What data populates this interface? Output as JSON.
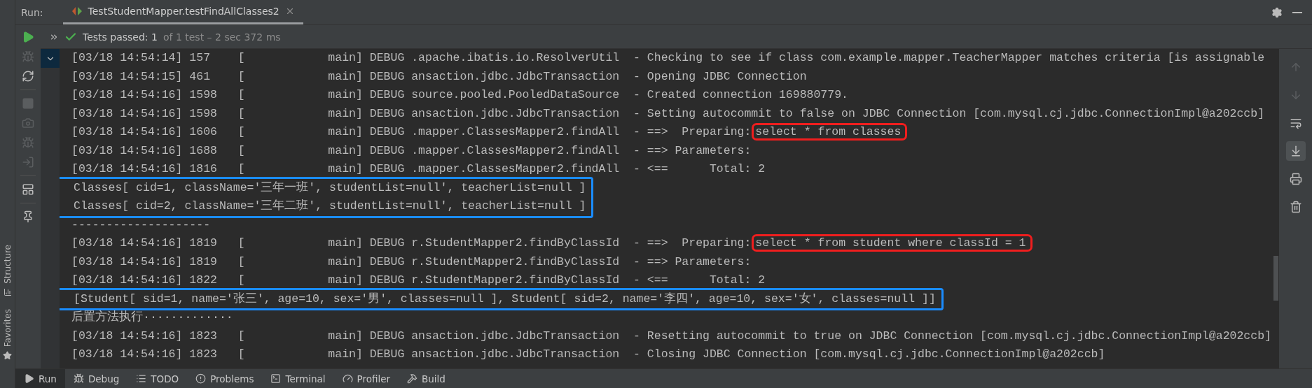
{
  "run_tab": {
    "label": "Run:",
    "title": "TestStudentMapper.testFindAllClasses2",
    "selected": true
  },
  "tests_status": {
    "passed": "Tests passed: 1",
    "detail": "of 1 test – 2 sec 372 ms"
  },
  "side_panels": [
    {
      "label": "Structure"
    },
    {
      "label": "Favorites"
    }
  ],
  "console": {
    "blocks": [
      {
        "kind": "line",
        "text": "[03/18 14:54:14] 157    [            main] DEBUG .apache.ibatis.io.ResolverUtil  - Checking to see if class com.example.mapper.TeacherMapper matches criteria [is assignable"
      },
      {
        "kind": "line",
        "text": "[03/18 14:54:15] 461    [            main] DEBUG ansaction.jdbc.JdbcTransaction  - Opening JDBC Connection"
      },
      {
        "kind": "line",
        "text": "[03/18 14:54:16] 1598   [            main] DEBUG source.pooled.PooledDataSource  - Created connection 169880779."
      },
      {
        "kind": "line",
        "text": "[03/18 14:54:16] 1598   [            main] DEBUG ansaction.jdbc.JdbcTransaction  - Setting autocommit to false on JDBC Connection [com.mysql.cj.jdbc.ConnectionImpl@a202ccb]"
      },
      {
        "kind": "line",
        "text": "[03/18 14:54:16] 1606   [            main] DEBUG .mapper.ClassesMapper2.findAll  - ==>  Preparing:",
        "highlight": "select * from classes"
      },
      {
        "kind": "line",
        "text": "[03/18 14:54:16] 1688   [            main] DEBUG .mapper.ClassesMapper2.findAll  - ==> Parameters:"
      },
      {
        "kind": "line",
        "text": "[03/18 14:54:16] 1816   [            main] DEBUG .mapper.ClassesMapper2.findAll  - <==      Total: 2"
      },
      {
        "kind": "boxed",
        "lines": [
          "Classes[ cid=1, className='三年一班', studentList=null', teacherList=null ]",
          "Classes[ cid=2, className='三年二班', studentList=null', teacherList=null ]"
        ]
      },
      {
        "kind": "line",
        "text": "--------------------"
      },
      {
        "kind": "line",
        "text": "[03/18 14:54:16] 1819   [            main] DEBUG r.StudentMapper2.findByClassId  - ==>  Preparing:",
        "highlight": "select * from student where classId = 1"
      },
      {
        "kind": "line",
        "text": "[03/18 14:54:16] 1819   [            main] DEBUG r.StudentMapper2.findByClassId  - ==> Parameters:"
      },
      {
        "kind": "line",
        "text": "[03/18 14:54:16] 1822   [            main] DEBUG r.StudentMapper2.findByClassId  - <==      Total: 2"
      },
      {
        "kind": "boxed",
        "lines": [
          "[Student[ sid=1, name='张三', age=10, sex='男', classes=null ], Student[ sid=2, name='李四', age=10, sex='女', classes=null ]]"
        ]
      },
      {
        "kind": "line",
        "text": "后置方法执行·············"
      },
      {
        "kind": "line",
        "text": "[03/18 14:54:16] 1823   [            main] DEBUG ansaction.jdbc.JdbcTransaction  - Resetting autocommit to true on JDBC Connection [com.mysql.cj.jdbc.ConnectionImpl@a202ccb]"
      },
      {
        "kind": "line",
        "text": "[03/18 14:54:16] 1823   [            main] DEBUG ansaction.jdbc.JdbcTransaction  - Closing JDBC Connection [com.mysql.cj.jdbc.ConnectionImpl@a202ccb]"
      }
    ]
  },
  "bottom_tabs": [
    {
      "kind": "run",
      "label": "Run",
      "selected": true
    },
    {
      "kind": "debug",
      "label": "Debug",
      "selected": false
    },
    {
      "kind": "todo",
      "label": "TODO",
      "selected": false
    },
    {
      "kind": "problems",
      "label": "Problems",
      "selected": false
    },
    {
      "kind": "terminal",
      "label": "Terminal",
      "selected": false
    },
    {
      "kind": "profiler",
      "label": "Profiler",
      "selected": false
    },
    {
      "kind": "build",
      "label": "Build",
      "selected": false
    }
  ]
}
